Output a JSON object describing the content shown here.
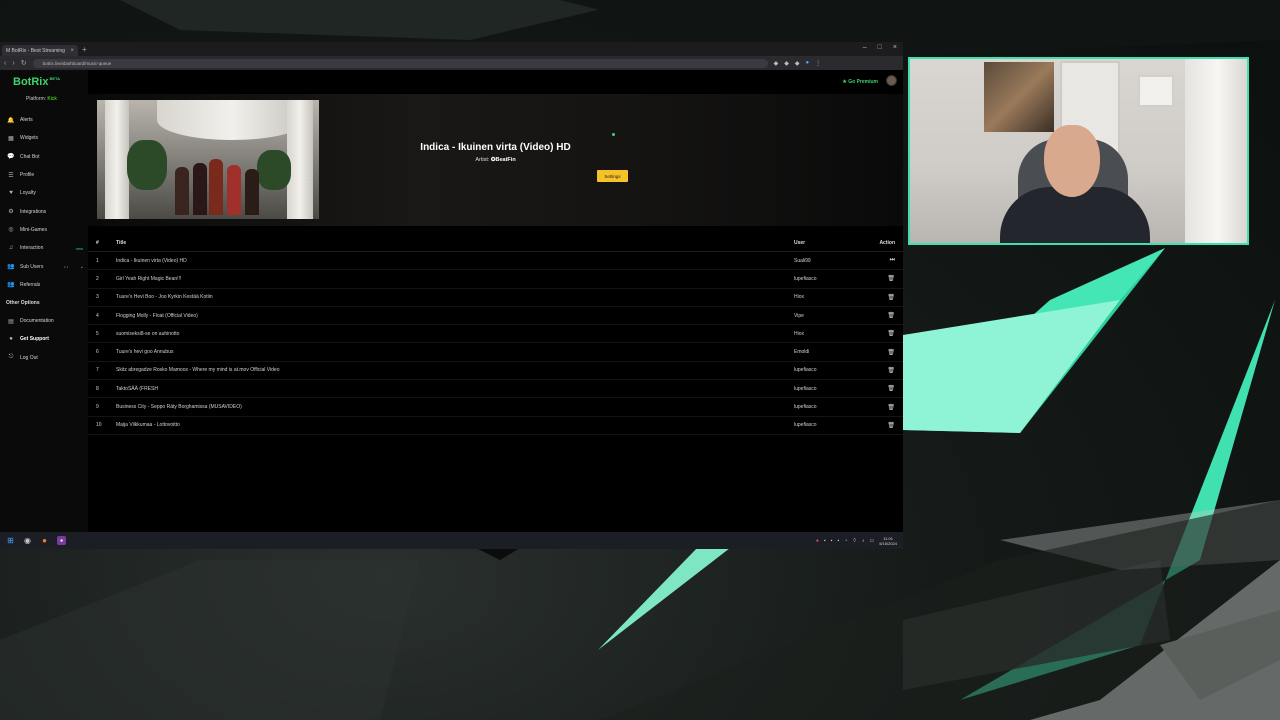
{
  "browser": {
    "tab_title": "M BotRix - Best Streaming",
    "tab_close": "×",
    "new_tab": "+",
    "window_controls": [
      "–",
      "□",
      "×"
    ],
    "url": "botrix.live/dashboard/music-queue"
  },
  "sidebar": {
    "logo": "BotRix",
    "logo_badge": "BETA",
    "platform_label": "Platform:",
    "platform_value": "Kick",
    "items": [
      {
        "label": "Alerts",
        "icon": "bell-icon",
        "glyph": "🔔"
      },
      {
        "label": "Widgets",
        "icon": "grid-icon",
        "glyph": "▦"
      },
      {
        "label": "Chat Bot",
        "icon": "chat-icon",
        "glyph": "💬"
      },
      {
        "label": "Profile",
        "icon": "profile-icon",
        "glyph": "☰"
      },
      {
        "label": "Loyalty",
        "icon": "heart-icon",
        "glyph": "♥"
      },
      {
        "label": "Integrations",
        "icon": "plug-icon",
        "glyph": "⚙"
      },
      {
        "label": "Mini-Games",
        "icon": "gamepad-icon",
        "glyph": "◎"
      },
      {
        "label": "Interaction",
        "icon": "music-icon",
        "glyph": "♫",
        "tag": "new"
      },
      {
        "label": "Sub Users",
        "icon": "users-icon",
        "glyph": "👥",
        "dots": "• •"
      },
      {
        "label": "Referrals",
        "icon": "referral-icon",
        "glyph": "👥"
      }
    ],
    "other_heading": "Other Options",
    "other_items": [
      {
        "label": "Documentation",
        "icon": "book-icon",
        "glyph": "▤"
      },
      {
        "label": "Get Support",
        "icon": "support-icon",
        "glyph": "●"
      },
      {
        "label": "Log Out",
        "icon": "logout-icon",
        "glyph": "⎋"
      }
    ]
  },
  "header": {
    "premium": "Go Premium",
    "premium_icon": "★"
  },
  "now_playing": {
    "title": "Indica - Ikuinen virta (Video) HD",
    "artist_label": "Artist:",
    "artist": "✪BeatFin",
    "settings_button": "Settings",
    "fullscreen_icon": "⛶"
  },
  "queue": {
    "columns": {
      "num": "#",
      "title": "Title",
      "user": "User",
      "action": "Action"
    },
    "rows": [
      {
        "num": "1",
        "title": "Indica - Ikuinen virta (Video) HD",
        "user": "Suali99",
        "action": "⏭"
      },
      {
        "num": "2",
        "title": "Girl Yeah Right Magic Bean!!!",
        "user": "lupefiasco",
        "action": "🗑"
      },
      {
        "num": "3",
        "title": "Tuure's Hevi Boo - Joo Kyrkin Kestää Kotiin",
        "user": "Hiox",
        "action": "🗑"
      },
      {
        "num": "4",
        "title": "Flogging Molly - Float (Official Video)",
        "user": "Vipe",
        "action": "🗑"
      },
      {
        "num": "5",
        "title": "suomiseksi8-se on auhinotto",
        "user": "Hiox",
        "action": "🗑"
      },
      {
        "num": "6",
        "title": "Tuure's hevi goo Annubus",
        "user": "Emoldi",
        "action": "🗑"
      },
      {
        "num": "7",
        "title": "Skitz abregadze Rosko Mamoos - Where my mind is at.mov Official Video",
        "user": "lupefiasco",
        "action": "🗑"
      },
      {
        "num": "8",
        "title": "TaktoSÄÄ (FRESH",
        "user": "lupefiasco",
        "action": "🗑"
      },
      {
        "num": "9",
        "title": "Business City - Seppo Räty Borghamissa (MUSAVIDEO)",
        "user": "lupefiasco",
        "action": "🗑"
      },
      {
        "num": "10",
        "title": "Maija Vilkkumaa - Lottovoitto",
        "user": "lupefiasco",
        "action": "🗑"
      }
    ]
  },
  "taskbar": {
    "clock_time": "11:01",
    "clock_date": "5/15/2024"
  }
}
